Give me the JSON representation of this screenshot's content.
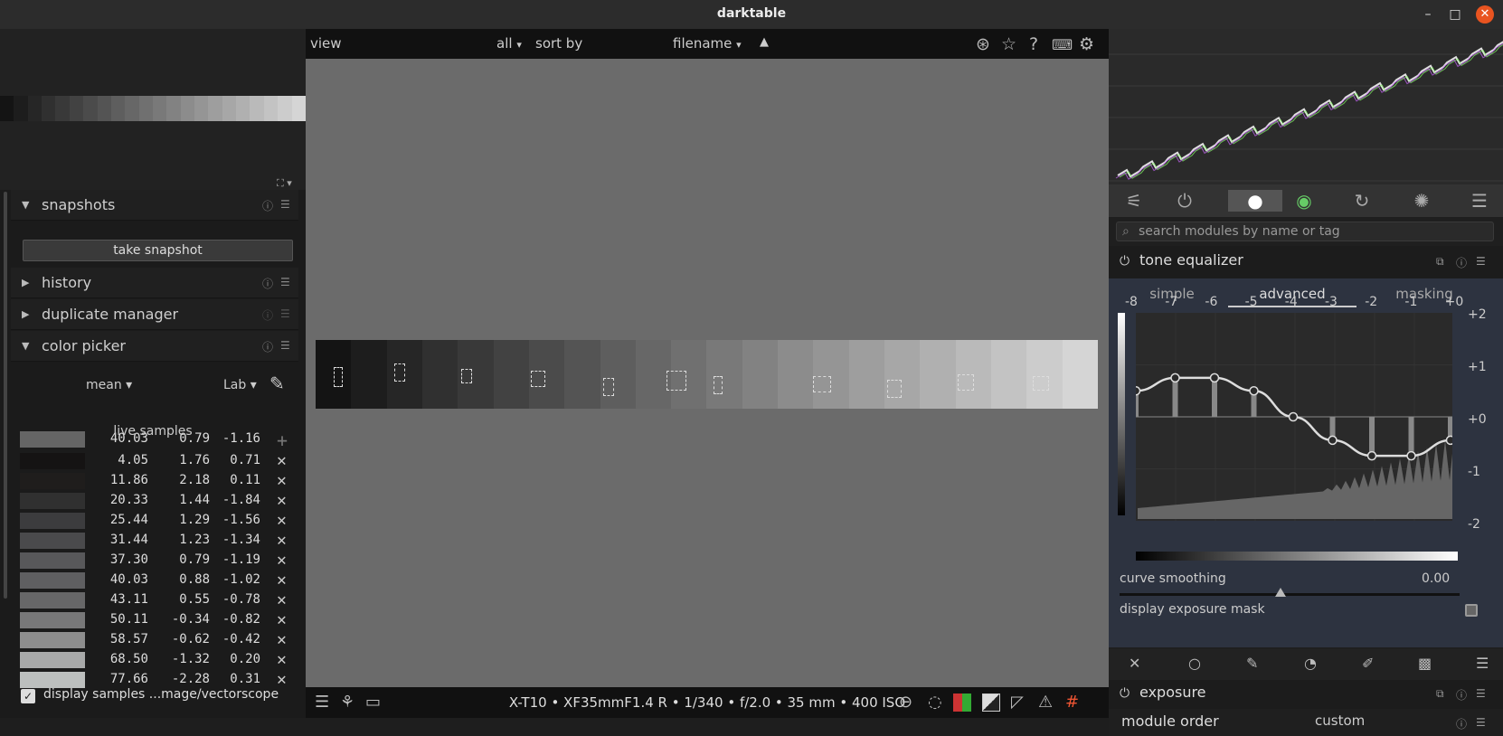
{
  "window": {
    "title": "darktable",
    "minimize": "–",
    "maximize": "□",
    "close": "✕"
  },
  "left": {
    "snapshots": {
      "label": "snapshots",
      "button": "take snapshot"
    },
    "history": {
      "label": "history"
    },
    "duplicate": {
      "label": "duplicate manager"
    },
    "picker": {
      "label": "color picker",
      "stat": "mean",
      "space": "Lab",
      "mean": {
        "color": "#656565",
        "v": [
          "40.03",
          "0.79",
          "-1.16"
        ]
      },
      "live_label": "live samples",
      "samples": [
        {
          "color": "#151313",
          "v": [
            "4.05",
            "1.76",
            "0.71"
          ]
        },
        {
          "color": "#1f1d1c",
          "v": [
            "11.86",
            "2.18",
            "0.11"
          ]
        },
        {
          "color": "#303030",
          "v": [
            "20.33",
            "1.44",
            "-1.84"
          ]
        },
        {
          "color": "#3c3c3e",
          "v": [
            "25.44",
            "1.29",
            "-1.56"
          ]
        },
        {
          "color": "#4a4a4c",
          "v": [
            "31.44",
            "1.23",
            "-1.34"
          ]
        },
        {
          "color": "#58585a",
          "v": [
            "37.30",
            "0.79",
            "-1.19"
          ]
        },
        {
          "color": "#5f5f61",
          "v": [
            "40.03",
            "0.88",
            "-1.02"
          ]
        },
        {
          "color": "#676768",
          "v": [
            "43.11",
            "0.55",
            "-0.78"
          ]
        },
        {
          "color": "#787879",
          "v": [
            "50.11",
            "-0.34",
            "-0.82"
          ]
        },
        {
          "color": "#8e8e8e",
          "v": [
            "58.57",
            "-0.62",
            "-0.42"
          ]
        },
        {
          "color": "#a8a9a9",
          "v": [
            "68.50",
            "-1.32",
            "0.20"
          ]
        },
        {
          "color": "#bcbfbe",
          "v": [
            "77.66",
            "-2.28",
            "0.31"
          ]
        }
      ],
      "display_samples": "display samples ...mage/vectorscope"
    }
  },
  "center": {
    "topbar": {
      "view": "view",
      "filter": "all",
      "sort_by": "sort by",
      "sort_field": "filename",
      "sort_dir": "▲"
    },
    "info": "X-T10 • XF35mmF1.4 R • 1/340 • f/2.0 • 35 mm • 400 ISO"
  },
  "right": {
    "search_placeholder": "search modules by name or tag",
    "tone_eq": {
      "title": "tone equalizer",
      "tabs": [
        "simple",
        "advanced",
        "masking"
      ],
      "xlabels": [
        "-8",
        "-7",
        "-6",
        "-5",
        "-4",
        "-3",
        "-2",
        "-1",
        "+0"
      ],
      "ylabels": [
        "+2",
        "+1",
        "+0",
        "-1",
        "-2"
      ],
      "curve_smoothing_label": "curve smoothing",
      "curve_smoothing_value": "0.00",
      "display_mask": "display exposure mask",
      "bands": [
        0.5,
        0.75,
        0.75,
        0.5,
        0,
        -0.45,
        -0.75,
        -0.75,
        -0.45
      ]
    },
    "exposure": {
      "title": "exposure"
    },
    "module_order": {
      "label": "module order",
      "value": "custom"
    }
  }
}
